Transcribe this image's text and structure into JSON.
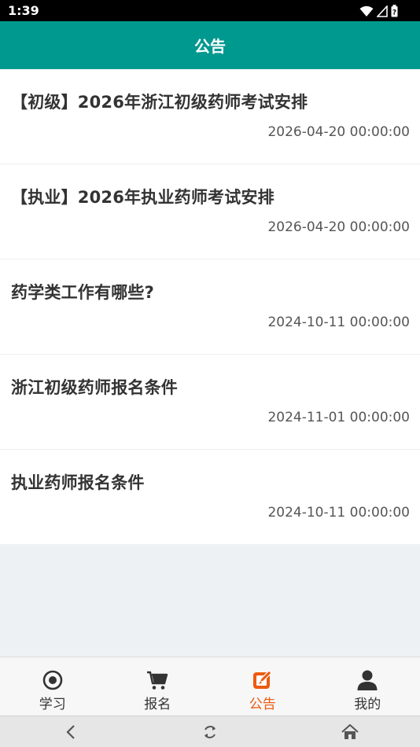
{
  "status_bar": {
    "time": "1:39",
    "icons": [
      "wifi-icon",
      "signal-icon",
      "battery-icon"
    ]
  },
  "header": {
    "title": "公告"
  },
  "notices": [
    {
      "title": "【初级】2026年浙江初级药师考试安排",
      "date": "2026-04-20 00:00:00"
    },
    {
      "title": "【执业】2026年执业药师考试安排",
      "date": "2026-04-20 00:00:00"
    },
    {
      "title": "药学类工作有哪些?",
      "date": "2024-10-11 00:00:00"
    },
    {
      "title": "浙江初级药师报名条件",
      "date": "2024-11-01 00:00:00"
    },
    {
      "title": "执业药师报名条件",
      "date": "2024-10-11 00:00:00"
    }
  ],
  "tabs": [
    {
      "label": "学习",
      "icon": "target-icon",
      "active": false
    },
    {
      "label": "报名",
      "icon": "cart-icon",
      "active": false
    },
    {
      "label": "公告",
      "icon": "edit-note-icon",
      "active": true
    },
    {
      "label": "我的",
      "icon": "user-icon",
      "active": false
    }
  ],
  "nav_bar": {
    "icons": [
      "back-icon",
      "rotate-icon",
      "home-icon"
    ]
  },
  "colors": {
    "header_bg": "#00998f",
    "active_tab": "#ee5a10",
    "inactive_tab": "#333333"
  }
}
